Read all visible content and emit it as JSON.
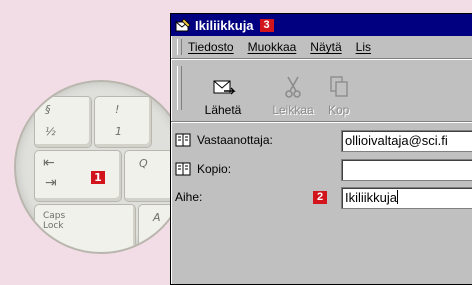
{
  "keyboard": {
    "callout": "1",
    "keys": {
      "digit_top": "§",
      "digit_bottom": "½",
      "one_top": "!",
      "one_bottom": "1",
      "tab_top": "⇤",
      "tab_bottom": "⇥",
      "q": "Q",
      "a": "A",
      "caps": "Caps\nLock"
    }
  },
  "window": {
    "title": "Ikiliikkuja",
    "title_callout": "3",
    "menu": [
      "Tiedosto",
      "Muokkaa",
      "Näytä",
      "Lis"
    ],
    "toolbar": [
      {
        "label": "Lähetä",
        "icon": "send-icon",
        "enabled": true
      },
      {
        "label": "Leikkaa",
        "icon": "scissors-icon",
        "enabled": false
      },
      {
        "label": "Kop",
        "icon": "copy-icon",
        "enabled": false
      }
    ],
    "fields": {
      "to_label": "Vastaanottaja:",
      "to_value": "ollioivaltaja@sci.fi",
      "cc_label": "Kopio:",
      "cc_value": "",
      "subject_label": "Aihe:",
      "subject_callout": "2",
      "subject_value": "Ikiliikkuja"
    }
  }
}
